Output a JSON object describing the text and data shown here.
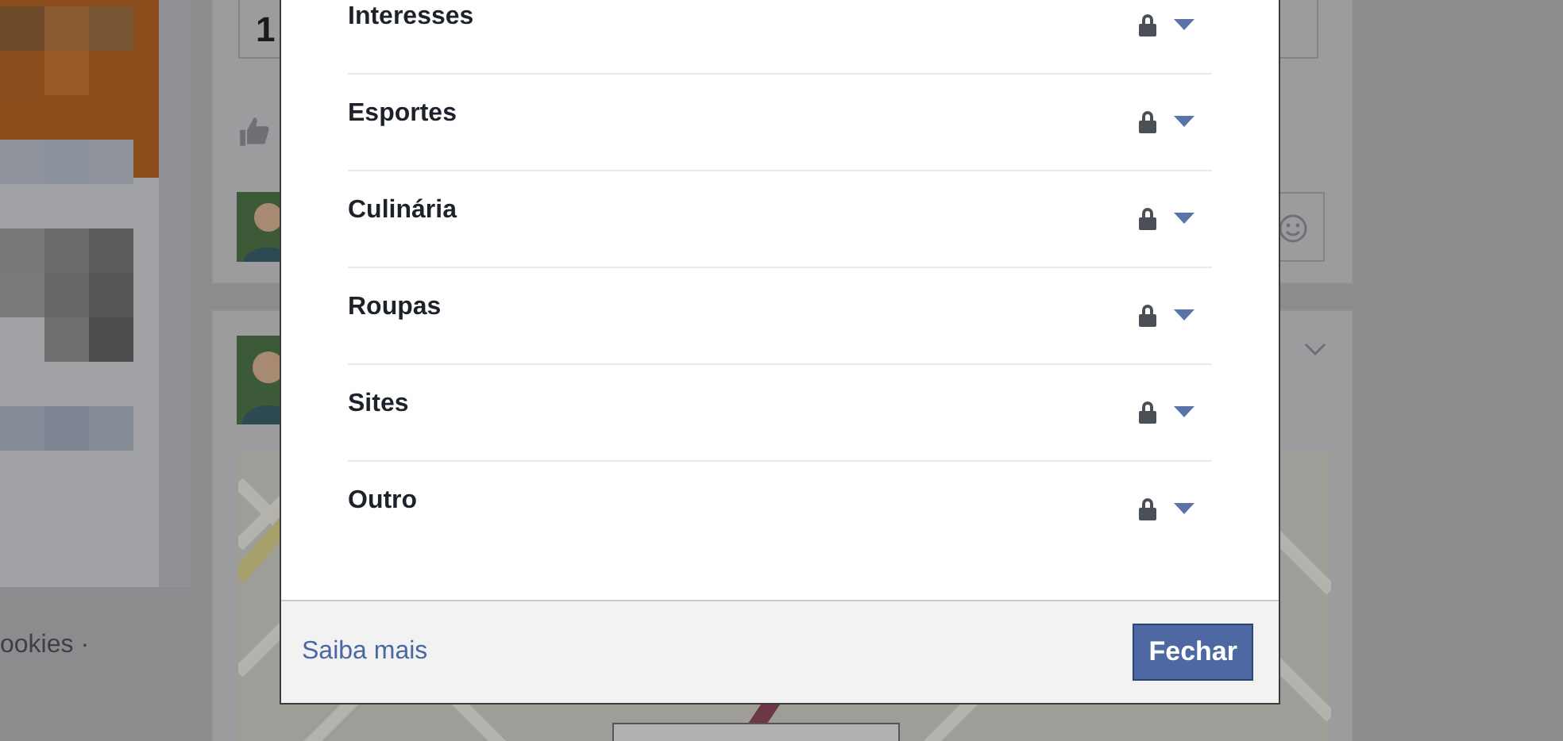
{
  "background": {
    "card_text": "1",
    "footer_text": "ookies ·"
  },
  "dialog": {
    "rows": [
      {
        "label": "Interesses"
      },
      {
        "label": "Esportes"
      },
      {
        "label": "Culinária"
      },
      {
        "label": "Roupas"
      },
      {
        "label": "Sites"
      },
      {
        "label": "Outro"
      }
    ],
    "footer": {
      "link": "Saiba mais",
      "button": "Fechar"
    }
  }
}
